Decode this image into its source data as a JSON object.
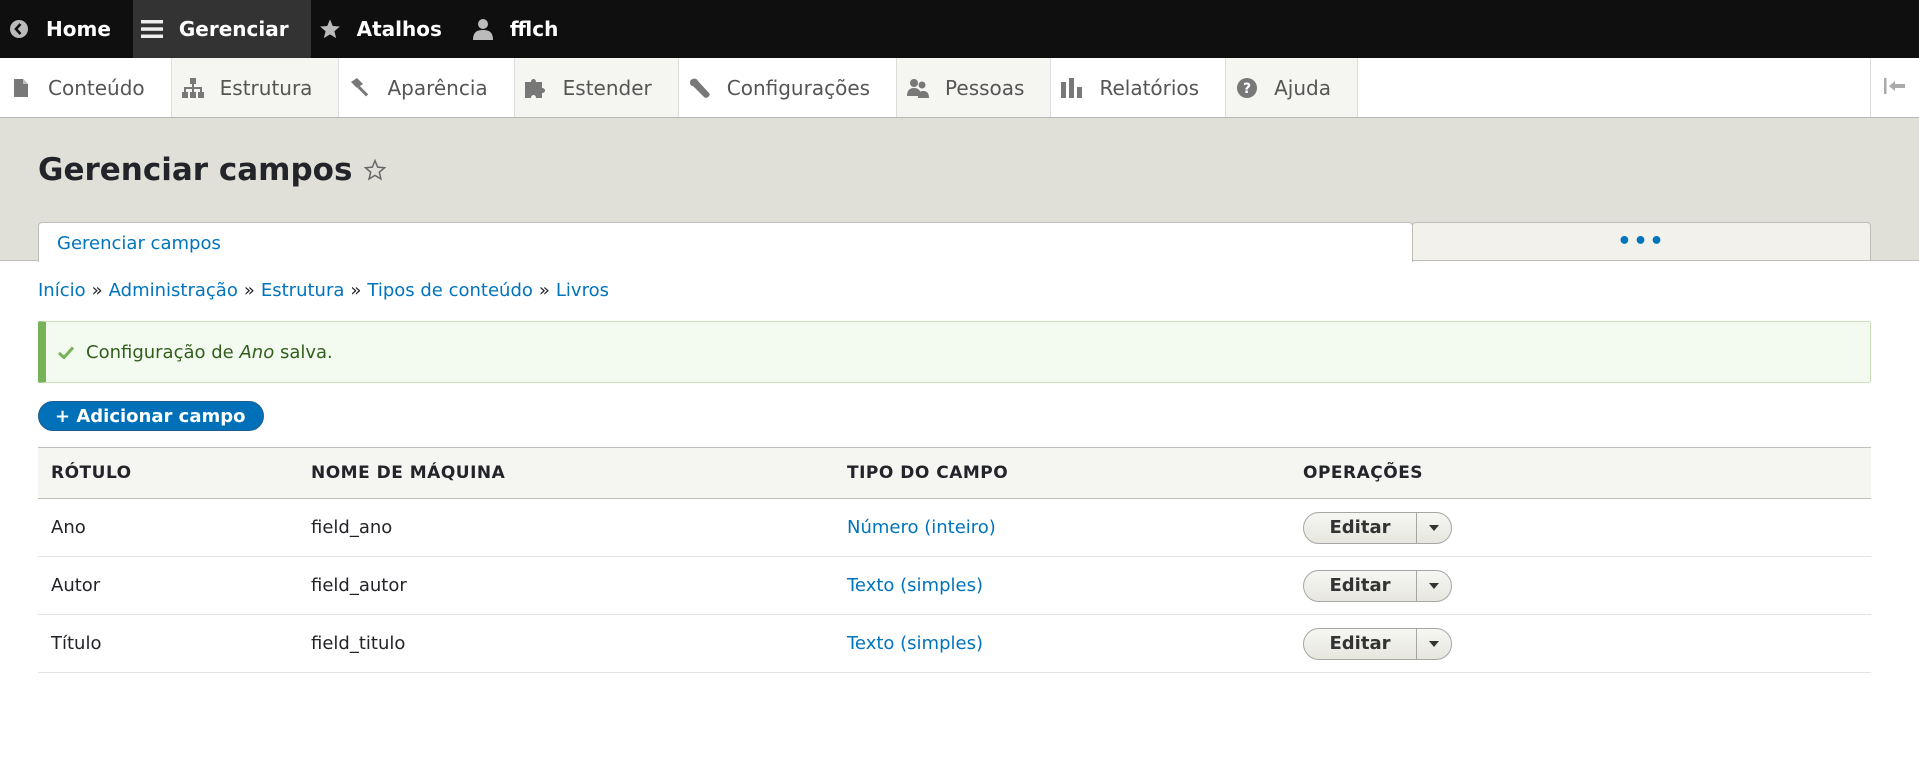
{
  "toolbar": {
    "items": [
      {
        "label": "Home",
        "icon": "back-arrow-circle-icon"
      },
      {
        "label": "Gerenciar",
        "icon": "hamburger-menu-icon",
        "active": true
      },
      {
        "label": "Atalhos",
        "icon": "star-icon"
      },
      {
        "label": "fflch",
        "icon": "user-icon"
      }
    ]
  },
  "tray": {
    "items": [
      {
        "label": "Conteúdo",
        "icon": "document-icon"
      },
      {
        "label": "Estrutura",
        "icon": "sitemap-icon"
      },
      {
        "label": "Aparência",
        "icon": "paint-brush-icon"
      },
      {
        "label": "Estender",
        "icon": "puzzle-icon"
      },
      {
        "label": "Configurações",
        "icon": "wrench-icon"
      },
      {
        "label": "Pessoas",
        "icon": "people-icon"
      },
      {
        "label": "Relatórios",
        "icon": "bar-chart-icon"
      },
      {
        "label": "Ajuda",
        "icon": "help-icon"
      }
    ],
    "collapse_icon": "collapse-tray-icon"
  },
  "page": {
    "title": "Gerenciar campos",
    "active_tab": "Gerenciar campos",
    "more_tabs": "•••"
  },
  "breadcrumb": {
    "items": [
      "Início",
      "Administração",
      "Estrutura",
      "Tipos de conteúdo",
      "Livros"
    ],
    "separator": "»"
  },
  "message": {
    "prefix": "Configuração de ",
    "field": "Ano",
    "suffix": " salva.",
    "color": "#77b259"
  },
  "add_button": {
    "label": "+ Adicionar campo"
  },
  "table": {
    "headers": [
      "RÓTULO",
      "NOME DE MÁQUINA",
      "TIPO DO CAMPO",
      "OPERAÇÕES"
    ],
    "rows": [
      {
        "label": "Ano",
        "machine": "field_ano",
        "type": "Número (inteiro)",
        "op": "Editar"
      },
      {
        "label": "Autor",
        "machine": "field_autor",
        "type": "Texto (simples)",
        "op": "Editar"
      },
      {
        "label": "Título",
        "machine": "field_titulo",
        "type": "Texto (simples)",
        "op": "Editar"
      }
    ]
  },
  "colors": {
    "toolbar": "#0f0f0f",
    "link": "#0074bd",
    "primary_button": "#0071b8"
  }
}
